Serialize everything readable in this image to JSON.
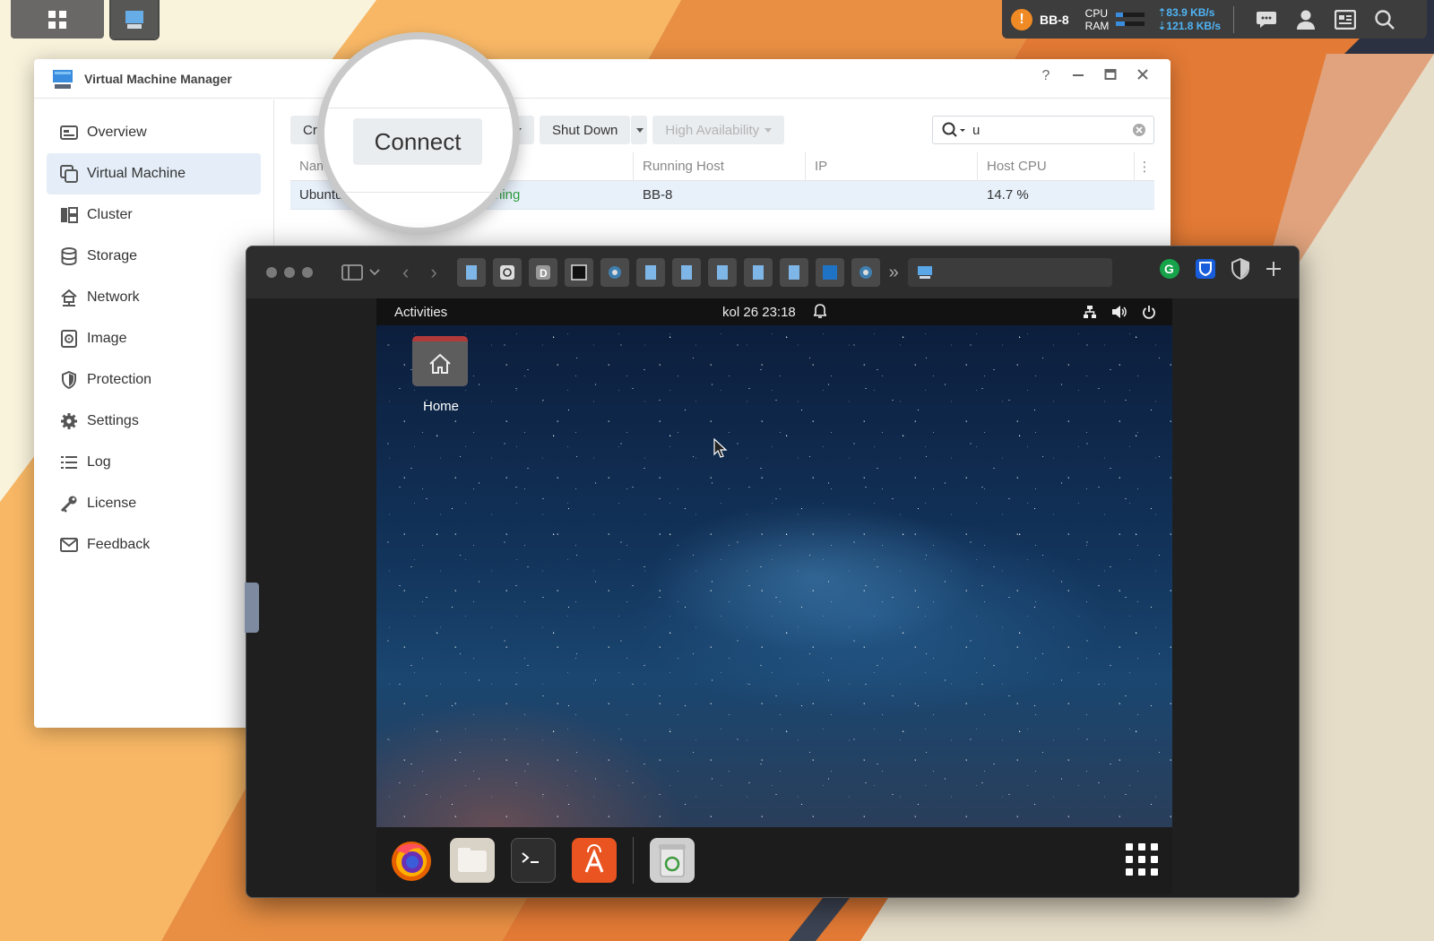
{
  "colors": {
    "accent": "#3a8dde",
    "running": "#2e9e3e",
    "warning": "#f08a24",
    "nav_active": "#e5eef8"
  },
  "taskbar": {
    "host": "BB-8",
    "cpu_label": "CPU",
    "ram_label": "RAM",
    "cpu_usage_fraction": 0.25,
    "ram_usage_fraction": 0.3,
    "upload": "83.9 KB/s",
    "download": "121.8 KB/s",
    "icons": [
      "chat-icon",
      "user-icon",
      "widgets-icon",
      "search-icon"
    ]
  },
  "vmm": {
    "title": "Virtual Machine Manager",
    "help": "?",
    "nav": [
      {
        "label": "Overview",
        "icon": "overview-icon"
      },
      {
        "label": "Virtual Machine",
        "icon": "virtual-machine-icon",
        "active": true
      },
      {
        "label": "Cluster",
        "icon": "cluster-icon"
      },
      {
        "label": "Storage",
        "icon": "storage-icon"
      },
      {
        "label": "Network",
        "icon": "network-icon"
      },
      {
        "label": "Image",
        "icon": "image-icon"
      },
      {
        "label": "Protection",
        "icon": "protection-icon"
      },
      {
        "label": "Settings",
        "icon": "settings-icon"
      },
      {
        "label": "Log",
        "icon": "log-icon"
      },
      {
        "label": "License",
        "icon": "license-icon"
      },
      {
        "label": "Feedback",
        "icon": "feedback-icon"
      }
    ],
    "toolbar": {
      "create": "Cre",
      "connect": "Connect",
      "shutdown": "Shut Down",
      "high_availability": "High Availability"
    },
    "search_value": "u",
    "columns": [
      "Name",
      "",
      "Running Host",
      "IP",
      "Host CPU"
    ],
    "rows": [
      {
        "name": "Ubuntu",
        "status": "ning",
        "host": "BB-8",
        "ip": "",
        "cpu": "14.7 %"
      }
    ]
  },
  "magnifier": {
    "label": "Connect"
  },
  "ubuntu": {
    "activities": "Activities",
    "clock": "kol 26  23:18",
    "home_label": "Home",
    "dock": [
      "firefox-icon",
      "files-icon",
      "terminal-icon",
      "software-center-icon",
      "trash-icon"
    ]
  }
}
